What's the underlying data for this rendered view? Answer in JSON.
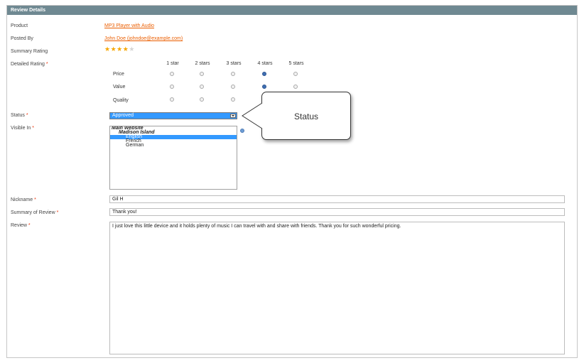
{
  "header": {
    "title": "Review Details"
  },
  "labels": {
    "product": "Product",
    "posted_by": "Posted By",
    "summary_rating": "Summary Rating",
    "detailed_rating": "Detailed Rating",
    "status": "Status",
    "visible_in": "Visible In",
    "nickname": "Nickname",
    "summary_of_review": "Summary of Review",
    "review": "Review",
    "required_marker": "*"
  },
  "product_link": "MP3 Player with Audio",
  "posted_by_link": "John Doe (johndoe@example.com)",
  "summary_rating": {
    "value": 4,
    "max": 5,
    "star_glyph": "★"
  },
  "detailed_rating": {
    "columns": [
      "1 star",
      "2 stars",
      "3 stars",
      "4 stars",
      "5 stars"
    ],
    "rows": [
      {
        "label": "Price",
        "selected": 4
      },
      {
        "label": "Value",
        "selected": 4
      },
      {
        "label": "Quality",
        "selected": 4
      }
    ]
  },
  "status": {
    "value": "Approved"
  },
  "visible_in": {
    "options": [
      {
        "label": "Main Website",
        "type": "group",
        "indent": 0
      },
      {
        "label": "Madison Island",
        "type": "group",
        "indent": 1
      },
      {
        "label": "English",
        "type": "option",
        "indent": 2,
        "selected": true
      },
      {
        "label": "French",
        "type": "option",
        "indent": 2,
        "selected": false
      },
      {
        "label": "German",
        "type": "option",
        "indent": 2,
        "selected": false
      }
    ]
  },
  "nickname": "Gil H",
  "summary_of_review": "Thank you!",
  "review_text": "I just love this little device and it holds plenty of music I can travel with and share with friends. Thank you for such wonderful pricing.",
  "callout": {
    "text": "Status"
  },
  "colors": {
    "header_bg": "#6f8992",
    "link": "#eb5e00",
    "star_on": "#f7a600",
    "star_off": "#d5d5d5",
    "selection": "#3399ff",
    "radio_on": "#3f6fb3",
    "required": "#eb340a"
  },
  "icons": {
    "help": "help-icon",
    "dropdown": "chevron-down-icon",
    "star": "star-icon"
  }
}
